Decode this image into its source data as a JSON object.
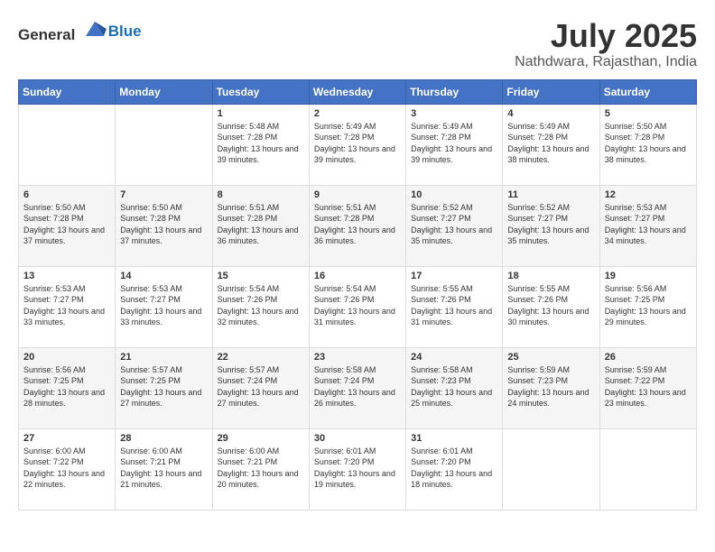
{
  "logo": {
    "text_general": "General",
    "text_blue": "Blue"
  },
  "title": {
    "month_year": "July 2025",
    "location": "Nathdwara, Rajasthan, India"
  },
  "headers": [
    "Sunday",
    "Monday",
    "Tuesday",
    "Wednesday",
    "Thursday",
    "Friday",
    "Saturday"
  ],
  "weeks": [
    [
      {
        "day": "",
        "sunrise": "",
        "sunset": "",
        "daylight": ""
      },
      {
        "day": "",
        "sunrise": "",
        "sunset": "",
        "daylight": ""
      },
      {
        "day": "1",
        "sunrise": "Sunrise: 5:48 AM",
        "sunset": "Sunset: 7:28 PM",
        "daylight": "Daylight: 13 hours and 39 minutes."
      },
      {
        "day": "2",
        "sunrise": "Sunrise: 5:49 AM",
        "sunset": "Sunset: 7:28 PM",
        "daylight": "Daylight: 13 hours and 39 minutes."
      },
      {
        "day": "3",
        "sunrise": "Sunrise: 5:49 AM",
        "sunset": "Sunset: 7:28 PM",
        "daylight": "Daylight: 13 hours and 39 minutes."
      },
      {
        "day": "4",
        "sunrise": "Sunrise: 5:49 AM",
        "sunset": "Sunset: 7:28 PM",
        "daylight": "Daylight: 13 hours and 38 minutes."
      },
      {
        "day": "5",
        "sunrise": "Sunrise: 5:50 AM",
        "sunset": "Sunset: 7:28 PM",
        "daylight": "Daylight: 13 hours and 38 minutes."
      }
    ],
    [
      {
        "day": "6",
        "sunrise": "Sunrise: 5:50 AM",
        "sunset": "Sunset: 7:28 PM",
        "daylight": "Daylight: 13 hours and 37 minutes."
      },
      {
        "day": "7",
        "sunrise": "Sunrise: 5:50 AM",
        "sunset": "Sunset: 7:28 PM",
        "daylight": "Daylight: 13 hours and 37 minutes."
      },
      {
        "day": "8",
        "sunrise": "Sunrise: 5:51 AM",
        "sunset": "Sunset: 7:28 PM",
        "daylight": "Daylight: 13 hours and 36 minutes."
      },
      {
        "day": "9",
        "sunrise": "Sunrise: 5:51 AM",
        "sunset": "Sunset: 7:28 PM",
        "daylight": "Daylight: 13 hours and 36 minutes."
      },
      {
        "day": "10",
        "sunrise": "Sunrise: 5:52 AM",
        "sunset": "Sunset: 7:27 PM",
        "daylight": "Daylight: 13 hours and 35 minutes."
      },
      {
        "day": "11",
        "sunrise": "Sunrise: 5:52 AM",
        "sunset": "Sunset: 7:27 PM",
        "daylight": "Daylight: 13 hours and 35 minutes."
      },
      {
        "day": "12",
        "sunrise": "Sunrise: 5:53 AM",
        "sunset": "Sunset: 7:27 PM",
        "daylight": "Daylight: 13 hours and 34 minutes."
      }
    ],
    [
      {
        "day": "13",
        "sunrise": "Sunrise: 5:53 AM",
        "sunset": "Sunset: 7:27 PM",
        "daylight": "Daylight: 13 hours and 33 minutes."
      },
      {
        "day": "14",
        "sunrise": "Sunrise: 5:53 AM",
        "sunset": "Sunset: 7:27 PM",
        "daylight": "Daylight: 13 hours and 33 minutes."
      },
      {
        "day": "15",
        "sunrise": "Sunrise: 5:54 AM",
        "sunset": "Sunset: 7:26 PM",
        "daylight": "Daylight: 13 hours and 32 minutes."
      },
      {
        "day": "16",
        "sunrise": "Sunrise: 5:54 AM",
        "sunset": "Sunset: 7:26 PM",
        "daylight": "Daylight: 13 hours and 31 minutes."
      },
      {
        "day": "17",
        "sunrise": "Sunrise: 5:55 AM",
        "sunset": "Sunset: 7:26 PM",
        "daylight": "Daylight: 13 hours and 31 minutes."
      },
      {
        "day": "18",
        "sunrise": "Sunrise: 5:55 AM",
        "sunset": "Sunset: 7:26 PM",
        "daylight": "Daylight: 13 hours and 30 minutes."
      },
      {
        "day": "19",
        "sunrise": "Sunrise: 5:56 AM",
        "sunset": "Sunset: 7:25 PM",
        "daylight": "Daylight: 13 hours and 29 minutes."
      }
    ],
    [
      {
        "day": "20",
        "sunrise": "Sunrise: 5:56 AM",
        "sunset": "Sunset: 7:25 PM",
        "daylight": "Daylight: 13 hours and 28 minutes."
      },
      {
        "day": "21",
        "sunrise": "Sunrise: 5:57 AM",
        "sunset": "Sunset: 7:25 PM",
        "daylight": "Daylight: 13 hours and 27 minutes."
      },
      {
        "day": "22",
        "sunrise": "Sunrise: 5:57 AM",
        "sunset": "Sunset: 7:24 PM",
        "daylight": "Daylight: 13 hours and 27 minutes."
      },
      {
        "day": "23",
        "sunrise": "Sunrise: 5:58 AM",
        "sunset": "Sunset: 7:24 PM",
        "daylight": "Daylight: 13 hours and 26 minutes."
      },
      {
        "day": "24",
        "sunrise": "Sunrise: 5:58 AM",
        "sunset": "Sunset: 7:23 PM",
        "daylight": "Daylight: 13 hours and 25 minutes."
      },
      {
        "day": "25",
        "sunrise": "Sunrise: 5:59 AM",
        "sunset": "Sunset: 7:23 PM",
        "daylight": "Daylight: 13 hours and 24 minutes."
      },
      {
        "day": "26",
        "sunrise": "Sunrise: 5:59 AM",
        "sunset": "Sunset: 7:22 PM",
        "daylight": "Daylight: 13 hours and 23 minutes."
      }
    ],
    [
      {
        "day": "27",
        "sunrise": "Sunrise: 6:00 AM",
        "sunset": "Sunset: 7:22 PM",
        "daylight": "Daylight: 13 hours and 22 minutes."
      },
      {
        "day": "28",
        "sunrise": "Sunrise: 6:00 AM",
        "sunset": "Sunset: 7:21 PM",
        "daylight": "Daylight: 13 hours and 21 minutes."
      },
      {
        "day": "29",
        "sunrise": "Sunrise: 6:00 AM",
        "sunset": "Sunset: 7:21 PM",
        "daylight": "Daylight: 13 hours and 20 minutes."
      },
      {
        "day": "30",
        "sunrise": "Sunrise: 6:01 AM",
        "sunset": "Sunset: 7:20 PM",
        "daylight": "Daylight: 13 hours and 19 minutes."
      },
      {
        "day": "31",
        "sunrise": "Sunrise: 6:01 AM",
        "sunset": "Sunset: 7:20 PM",
        "daylight": "Daylight: 13 hours and 18 minutes."
      },
      {
        "day": "",
        "sunrise": "",
        "sunset": "",
        "daylight": ""
      },
      {
        "day": "",
        "sunrise": "",
        "sunset": "",
        "daylight": ""
      }
    ]
  ]
}
